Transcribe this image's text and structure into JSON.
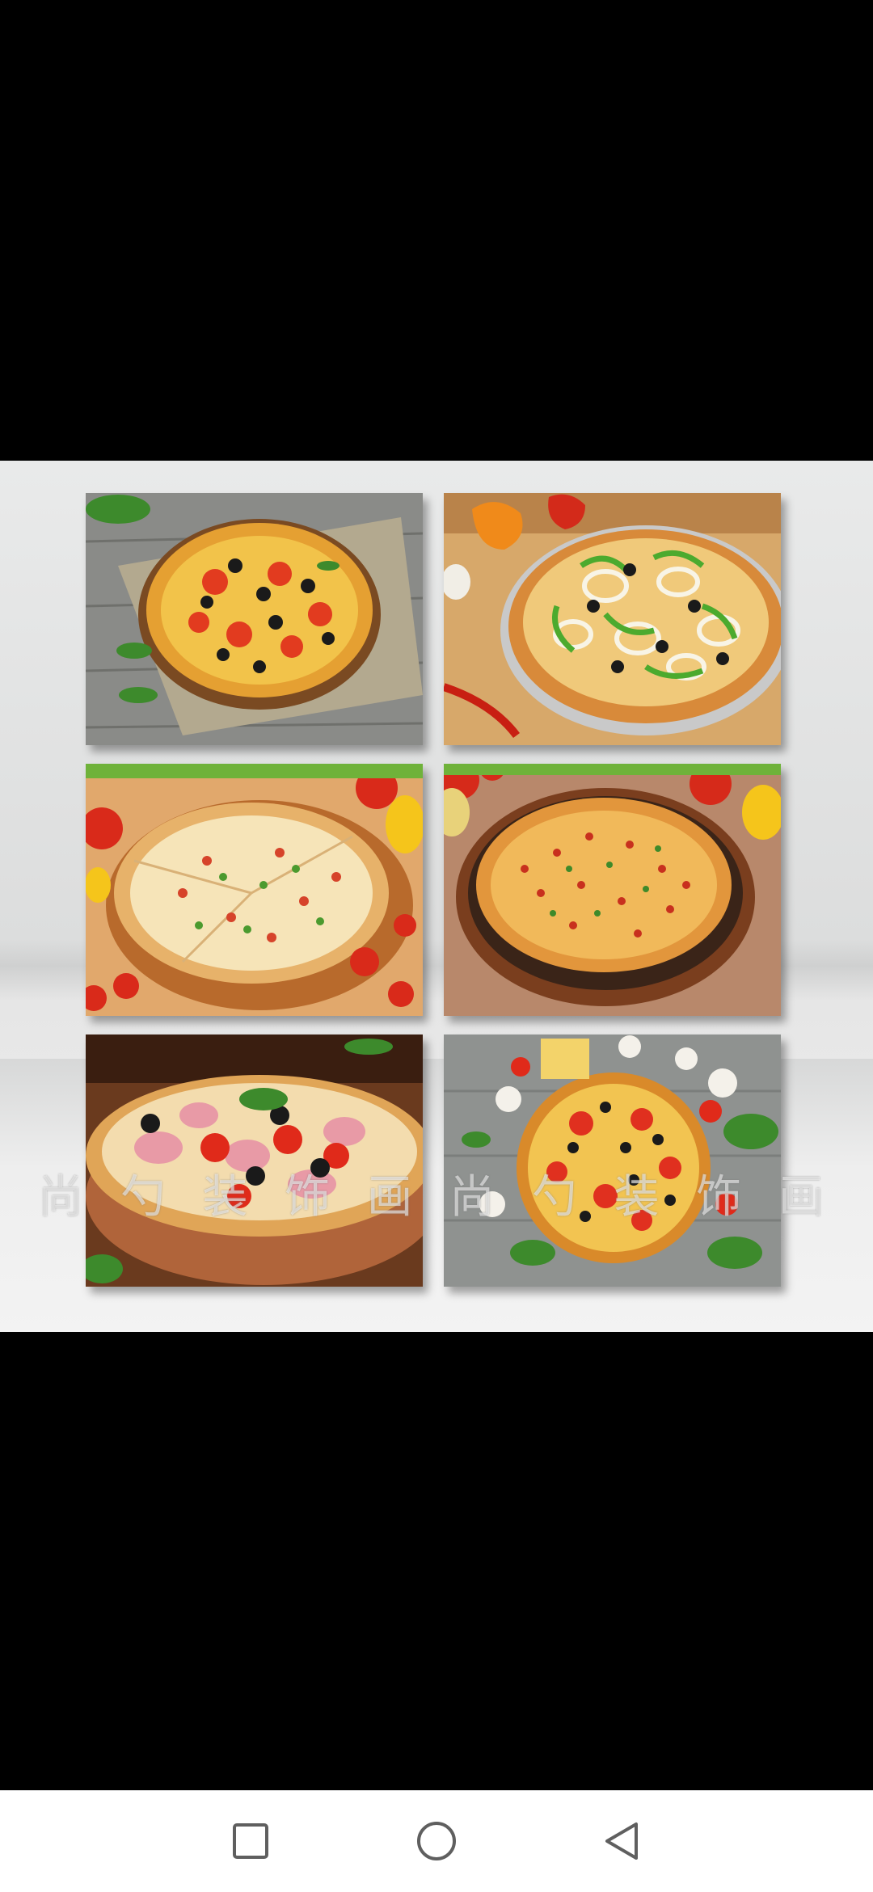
{
  "image_viewer": {
    "watermark": "尚 勺 装 饰 画 尚 勺 装 饰 画",
    "tiles": [
      {
        "icon": "pizza-olive-pepper-image"
      },
      {
        "icon": "pizza-green-pepper-onion-image"
      },
      {
        "icon": "pizza-sliced-peas-image"
      },
      {
        "icon": "pizza-pan-tomato-image"
      },
      {
        "icon": "pizza-ham-basil-image"
      },
      {
        "icon": "pizza-mushroom-cheese-image"
      }
    ]
  },
  "nav_bar": {
    "recents_icon": "square-icon",
    "home_icon": "circle-icon",
    "back_icon": "triangle-back-icon"
  },
  "colors": {
    "background": "#000000",
    "nav_bar": "#ffffff",
    "nav_icon": "#5f5f5f"
  }
}
